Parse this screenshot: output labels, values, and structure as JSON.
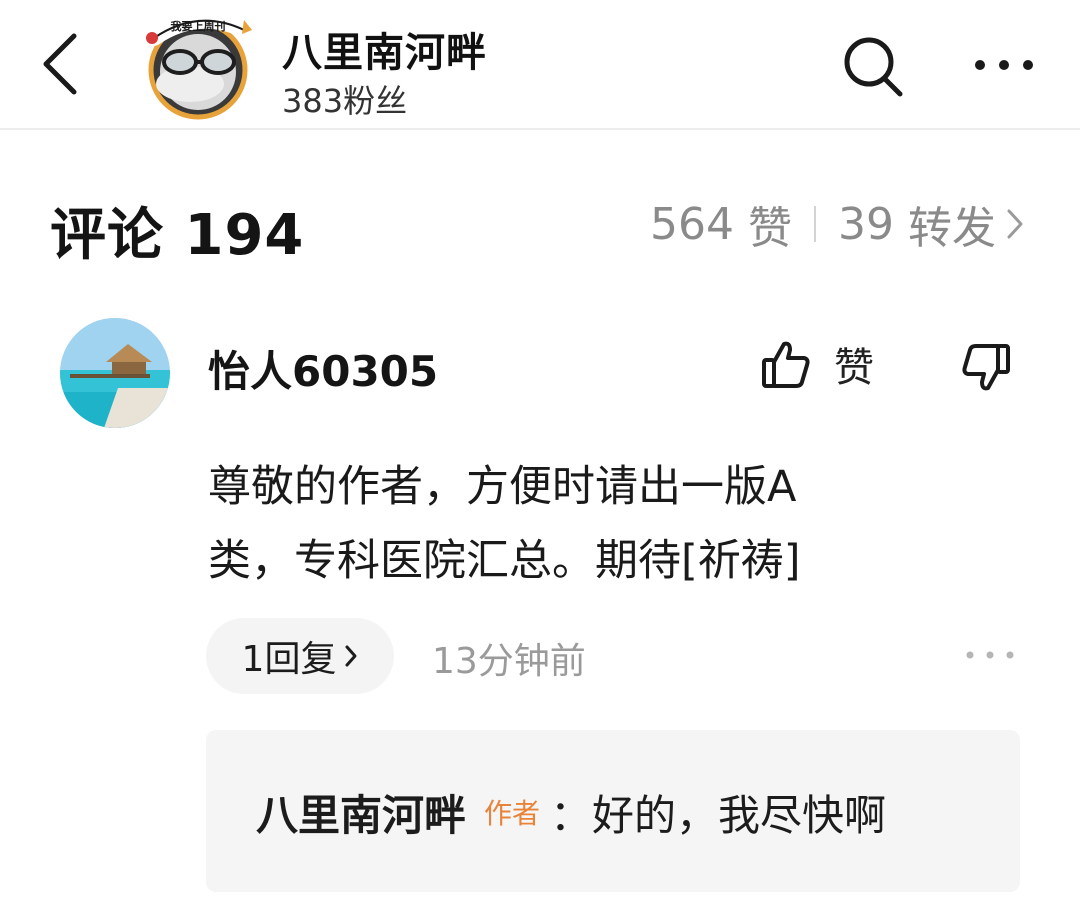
{
  "header": {
    "author_name": "八里南河畔",
    "fans": "383粉丝",
    "avatar_badge_text": "我要上周刊"
  },
  "comments_summary": {
    "title": "评论 194",
    "likes_count": "564",
    "likes_label": "赞",
    "reposts_count": "39",
    "reposts_label": "转发"
  },
  "comment": {
    "user_name": "怡人60305",
    "like_label": "赞",
    "text_line1": "尊敬的作者，方便时请出一版A",
    "text_line2": "类，专科医院汇总。期待[祈祷]",
    "reply_count_label": "1回复",
    "time": "13分钟前",
    "reply": {
      "name": "八里南河畔",
      "badge": "作者",
      "text": "：好的，我尽快啊"
    }
  },
  "colors": {
    "badge_orange": "#e8843a",
    "muted_gray": "#8a8a8a",
    "reply_bg": "#f5f5f5"
  },
  "icons": [
    "back-arrow-icon",
    "search-icon",
    "more-dots-icon",
    "thumbs-up-icon",
    "thumbs-down-icon",
    "chevron-right-icon"
  ]
}
